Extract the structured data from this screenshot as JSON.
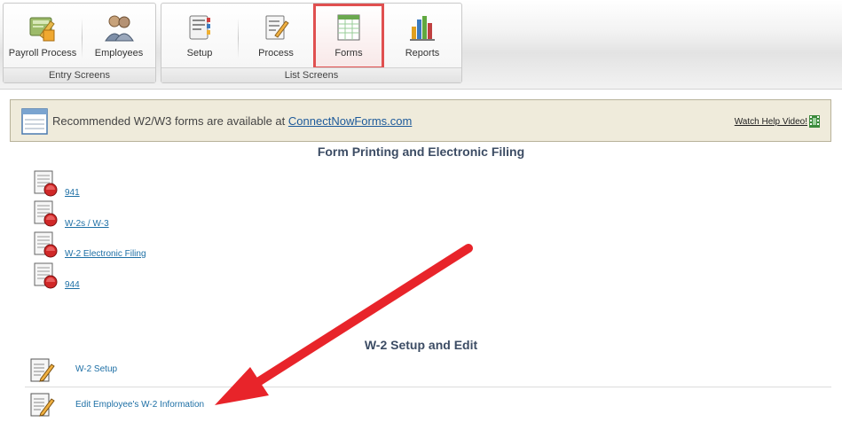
{
  "toolbar": {
    "entry_group": {
      "label": "Entry Screens",
      "buttons": [
        {
          "label": "Payroll Process",
          "icon": "payroll-process-icon"
        },
        {
          "label": "Employees",
          "icon": "employees-icon"
        }
      ]
    },
    "list_group": {
      "label": "List Screens",
      "buttons": [
        {
          "label": "Setup",
          "icon": "setup-icon"
        },
        {
          "label": "Process",
          "icon": "process-icon"
        },
        {
          "label": "Forms",
          "icon": "forms-icon",
          "selected": true
        },
        {
          "label": "Reports",
          "icon": "reports-icon"
        }
      ]
    },
    "highlight_color": "#e05050"
  },
  "notice": {
    "text": "Recommended W2/W3 forms are available at",
    "link": "ConnectNowForms.com",
    "help_link": "Watch Help Video!"
  },
  "forms_section": {
    "title": "Form Printing and Electronic Filing",
    "items": [
      {
        "label": "941"
      },
      {
        "label": "W-2s / W-3"
      },
      {
        "label": "W-2 Electronic Filing"
      },
      {
        "label": "944"
      }
    ]
  },
  "w2_section": {
    "title": "W-2 Setup and Edit",
    "items": [
      {
        "label": "W-2 Setup"
      },
      {
        "label": "Edit Employee's W-2 Information"
      }
    ]
  },
  "annotation": {
    "arrow_color": "#e8242a"
  }
}
